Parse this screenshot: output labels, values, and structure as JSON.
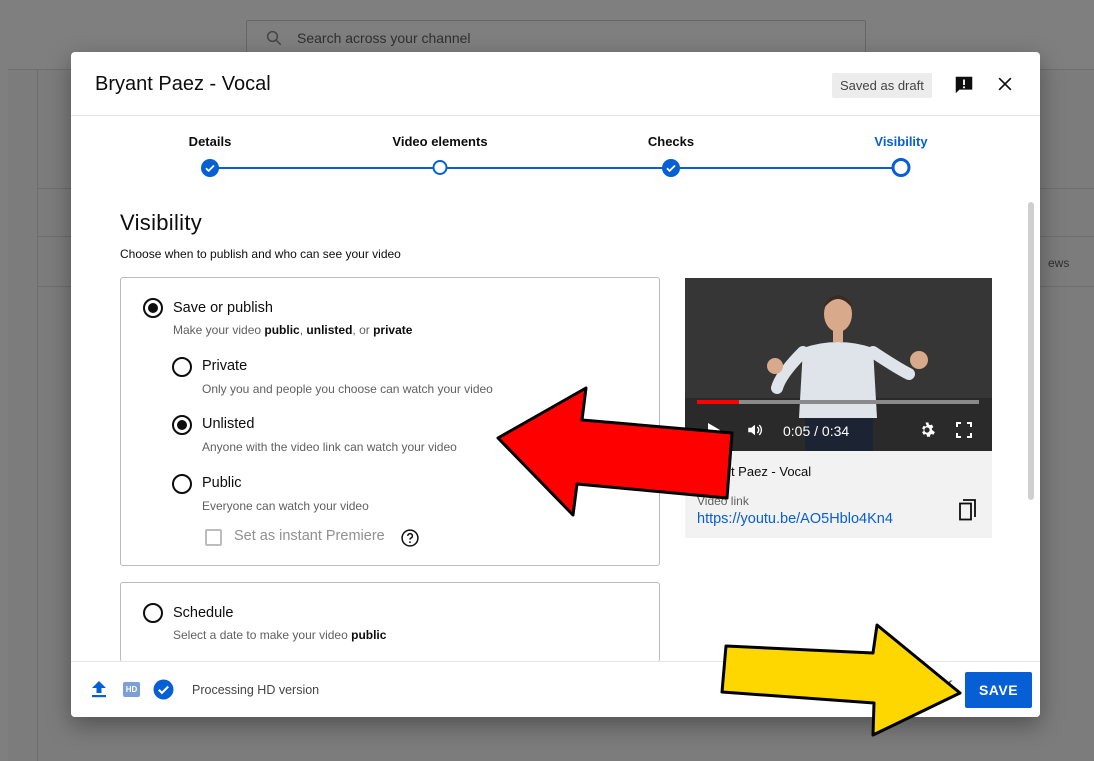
{
  "background": {
    "search_placeholder": "Search across your channel",
    "column_fragment": "ews"
  },
  "dialog": {
    "title": "Bryant Paez - Vocal",
    "draft_status": "Saved as draft"
  },
  "stepper": {
    "steps": [
      {
        "label": "Details",
        "state": "done"
      },
      {
        "label": "Video elements",
        "state": "visited"
      },
      {
        "label": "Checks",
        "state": "done"
      },
      {
        "label": "Visibility",
        "state": "current"
      }
    ]
  },
  "visibility": {
    "title": "Visibility",
    "subtitle": "Choose when to publish and who can see your video",
    "save_or_publish": {
      "label": "Save or publish",
      "desc_prefix": "Make your video ",
      "desc_public": "public",
      "desc_sep1": ", ",
      "desc_unlisted": "unlisted",
      "desc_sep2": ", or ",
      "desc_private": "private",
      "selected": true
    },
    "options": [
      {
        "label": "Private",
        "desc": "Only you and people you choose can watch your video",
        "selected": false
      },
      {
        "label": "Unlisted",
        "desc": "Anyone with the video link can watch your video",
        "selected": true
      },
      {
        "label": "Public",
        "desc": "Everyone can watch your video",
        "selected": false
      }
    ],
    "premiere_label": "Set as instant Premiere",
    "schedule": {
      "label": "Schedule",
      "desc_prefix": "Select a date to make your video ",
      "desc_bold": "public"
    }
  },
  "preview": {
    "time": "0:05 / 0:34",
    "progress": 0.15,
    "name": "Bryant Paez - Vocal",
    "link_label": "Video link",
    "link_url": "https://youtu.be/AO5Hblo4Kn4"
  },
  "footer": {
    "status": "Processing HD version",
    "hd_badge": "HD",
    "back_label": "BACK",
    "save_label": "SAVE"
  },
  "colors": {
    "accent": "#065fd4",
    "red_arrow": "#ff0000",
    "yellow_arrow": "#ffd700"
  }
}
